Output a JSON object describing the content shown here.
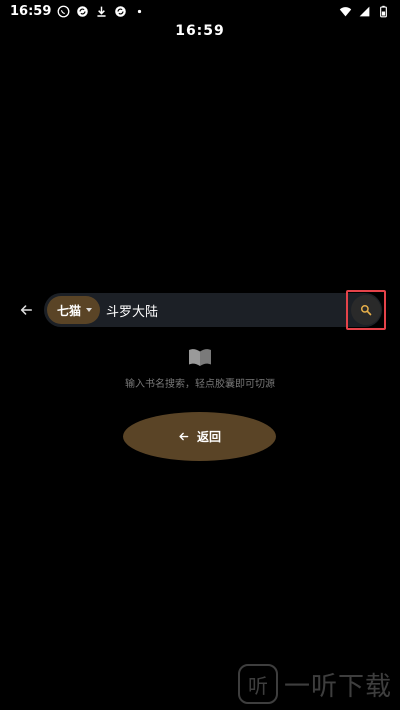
{
  "status_bar": {
    "time": "16:59",
    "left_icons": [
      "whatsapp-icon",
      "sync-icon",
      "download-icon",
      "sync-icon",
      "dot-icon"
    ],
    "right_icons": [
      "wifi-icon",
      "signal-icon",
      "battery-icon"
    ]
  },
  "top_clock": "16:59",
  "search": {
    "source_label": "七猫",
    "query": "斗罗大陆"
  },
  "empty_state": {
    "hint": "输入书名搜索，轻点胶囊即可切源"
  },
  "return_button": {
    "label": "返回"
  },
  "watermark": {
    "logo_char": "听",
    "text": "一听下载"
  },
  "colors": {
    "background": "#000000",
    "chip": "#5a4426",
    "search_box": "#1c2026",
    "highlight": "#e5434a"
  }
}
